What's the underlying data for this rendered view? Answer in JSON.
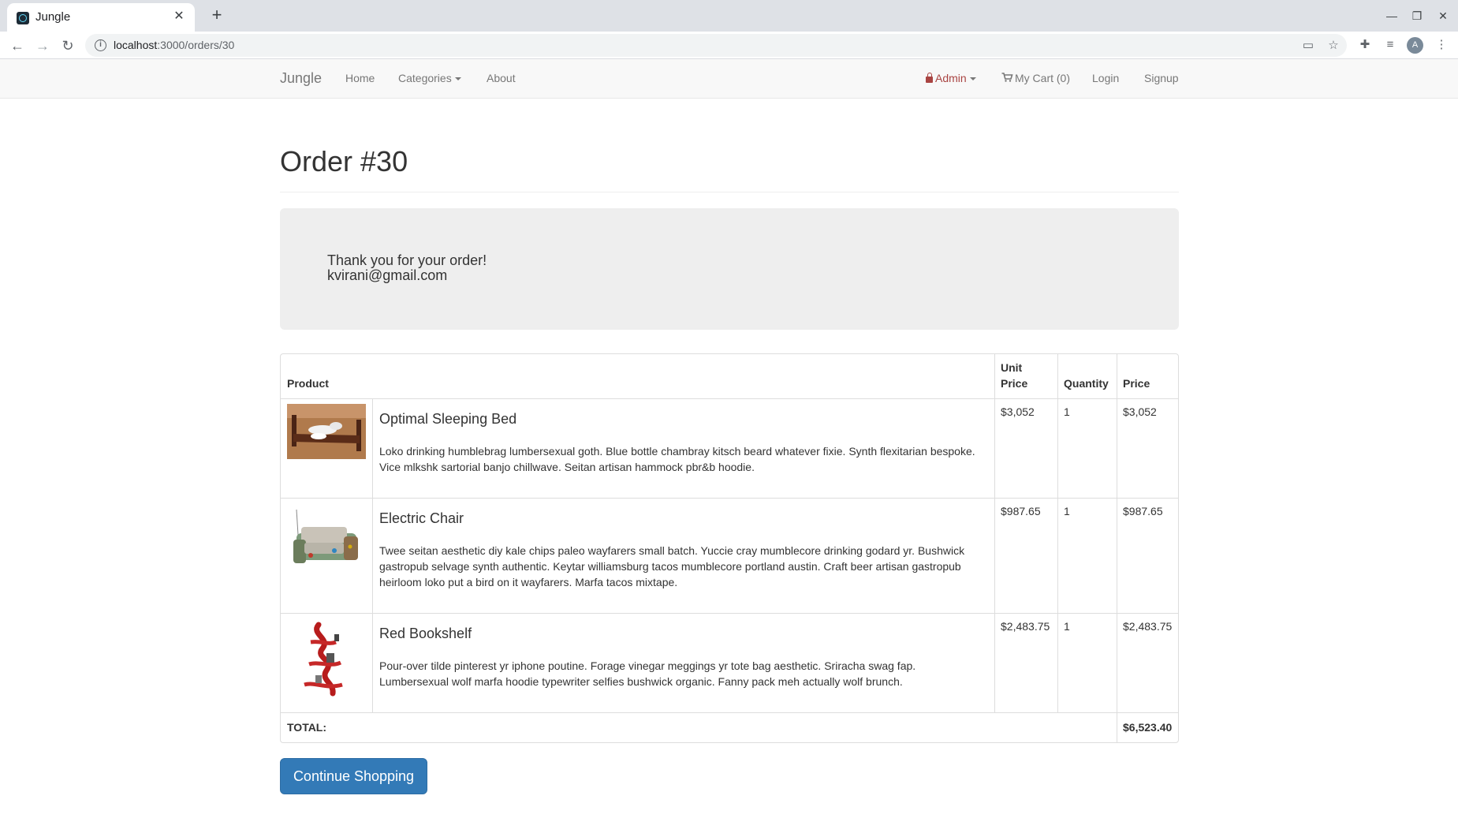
{
  "browser": {
    "tab_title": "Jungle",
    "url_host": "localhost",
    "url_path": ":3000/orders/30",
    "avatar_letter": "A"
  },
  "navbar": {
    "brand": "Jungle",
    "links": {
      "home": "Home",
      "categories": "Categories",
      "about": "About",
      "admin": "Admin",
      "cart": "My Cart (0)",
      "login": "Login",
      "signup": "Signup"
    },
    "admin_color": "#a94442"
  },
  "page": {
    "title": "Order #30",
    "thank_you": "Thank you for your order!",
    "email": "kvirani@gmail.com"
  },
  "table": {
    "headers": {
      "product": "Product",
      "unit_price_1": "Unit",
      "unit_price_2": "Price",
      "quantity": "Quantity",
      "price": "Price"
    },
    "items": [
      {
        "name": "Optimal Sleeping Bed",
        "description": "Loko drinking humblebrag lumbersexual goth. Blue bottle chambray kitsch beard whatever fixie. Synth flexitarian bespoke. Vice mlkshk sartorial banjo chillwave. Seitan artisan hammock pbr&b hoodie.",
        "unit_price": "$3,052",
        "quantity": "1",
        "price": "$3,052"
      },
      {
        "name": "Electric Chair",
        "description": "Twee seitan aesthetic diy kale chips paleo wayfarers small batch. Yuccie cray mumblecore drinking godard yr. Bushwick gastropub selvage synth authentic. Keytar williamsburg tacos mumblecore portland austin. Craft beer artisan gastropub heirloom loko put a bird on it wayfarers. Marfa tacos mixtape.",
        "unit_price": "$987.65",
        "quantity": "1",
        "price": "$987.65"
      },
      {
        "name": "Red Bookshelf",
        "description": "Pour-over tilde pinterest yr iphone poutine. Forage vinegar meggings yr tote bag aesthetic. Sriracha swag fap. Lumbersexual wolf marfa hoodie typewriter selfies bushwick organic. Fanny pack meh actually wolf brunch.",
        "unit_price": "$2,483.75",
        "quantity": "1",
        "price": "$2,483.75"
      }
    ],
    "total_label": "TOTAL:",
    "total_value": "$6,523.40"
  },
  "actions": {
    "continue_shopping": "Continue Shopping"
  },
  "colors": {
    "primary_button": "#337ab7",
    "jumbotron": "#eeeeee",
    "navbar": "#f8f8f8"
  }
}
